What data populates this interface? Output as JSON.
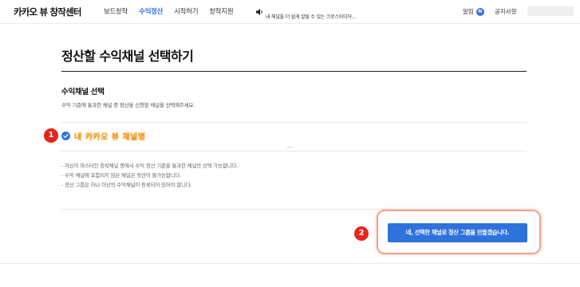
{
  "header": {
    "brand": "카카오 뷰 창작센터",
    "nav": [
      {
        "label": "보드창작",
        "active": false
      },
      {
        "label": "수익정산",
        "active": true
      },
      {
        "label": "시작하기",
        "active": false
      },
      {
        "label": "창작지원",
        "active": false
      }
    ],
    "notice_text": "내 채널을 더 쉽게 알릴 수 있는 크로스미디어…",
    "notice_icon": "speaker-icon",
    "alarm_label": "알림",
    "alarm_badge": "N",
    "notices_link": "공지사항"
  },
  "main": {
    "title": "정산할 수익채널 선택하기",
    "section_title": "수익채널 선택",
    "section_desc": "수익 기준에 통과한 채널 중 정산을 신청할 채널을 선택해주세요.",
    "channel": {
      "name": "내 카카오 뷰 채널명",
      "checked": true
    },
    "bullets": [
      "- 자신이 마스터인 창작채널 중에서 수익 정산 기준을 통과한 채널만 선택 가능합니다.",
      "- 수익 채널에 포함되지 않은 채널은 정산이 불가능합니다.",
      "- 정산 그룹은 하나 이상의 수익채널이 등록되어 있어야 합니다."
    ],
    "submit_label": "네, 선택한 채널로 정산 그룹을 만들겠습니다."
  },
  "annotations": {
    "step1": "1",
    "step2": "2"
  },
  "colors": {
    "accent": "#2e72dc",
    "step_badge": "#e8231b",
    "highlight": "#f5a08e",
    "channel_text": "#f28b00"
  }
}
